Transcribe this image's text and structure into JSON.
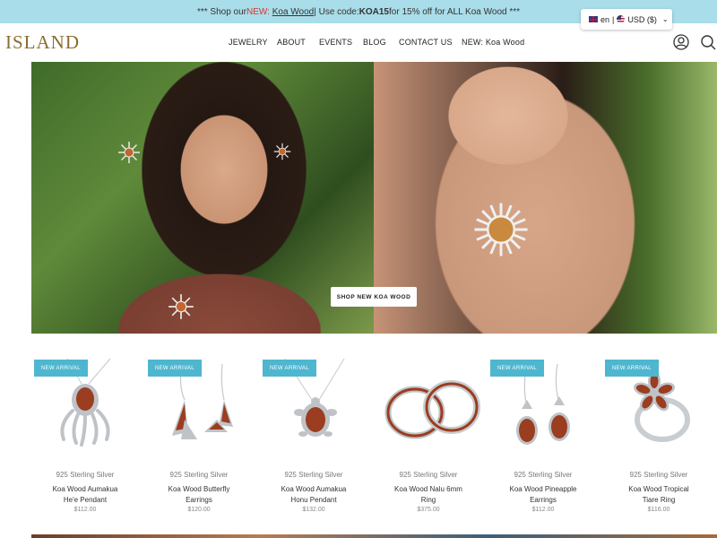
{
  "announcement": {
    "prefix": "*** Shop our ",
    "new_label": "NEW:",
    "link_text": "Koa Wood",
    "mid": " | Use code: ",
    "code": "KOA15",
    "suffix": " for 15% off for ALL Koa Wood ***"
  },
  "locale": {
    "language": "en",
    "separator": "|",
    "currency": "USD ($)"
  },
  "header": {
    "logo": "ISLAND",
    "nav": [
      "JEWELRY",
      "ABOUT",
      "EVENTS",
      "BLOG",
      "CONTACT US",
      "NEW: Koa Wood"
    ]
  },
  "hero": {
    "button_label": "SHOP NEW KOA WOOD"
  },
  "products": [
    {
      "badge": "NEW ARRIVAL",
      "material": "925 Sterling Silver",
      "name_line1": "Koa Wood Aumakua",
      "name_line2": "He'e Pendant",
      "price": "$112.00",
      "icon": "octopus-pendant-icon"
    },
    {
      "badge": "NEW ARRIVAL",
      "material": "925 Sterling Silver",
      "name_line1": "Koa Wood Butterfly",
      "name_line2": "Earrings",
      "price": "$120.00",
      "icon": "butterfly-earrings-icon"
    },
    {
      "badge": "NEW ARRIVAL",
      "material": "925 Sterling Silver",
      "name_line1": "Koa Wood Aumakua",
      "name_line2": "Honu Pendant",
      "price": "$132.00",
      "icon": "turtle-pendant-icon"
    },
    {
      "badge": "",
      "material": "925 Sterling Silver",
      "name_line1": "Koa Wood Nalu 6mm",
      "name_line2": "Ring",
      "price": "$375.00",
      "icon": "ring-icon"
    },
    {
      "badge": "NEW ARRIVAL",
      "material": "925 Sterling Silver",
      "name_line1": "Koa Wood Pineapple",
      "name_line2": "Earrings",
      "price": "$112.00",
      "icon": "pineapple-earrings-icon"
    },
    {
      "badge": "NEW ARRIVAL",
      "material": "925 Sterling Silver",
      "name_line1": "Koa Wood Tropical",
      "name_line2": "Tiare Ring",
      "price": "$116.00",
      "icon": "flower-ring-icon"
    }
  ],
  "colors": {
    "announcement_bg": "#a9dde9",
    "badge_bg": "#4fb6cf",
    "logo": "#8a6d2f",
    "koa": "#9a3d20",
    "silver": "#bfc3c7"
  }
}
